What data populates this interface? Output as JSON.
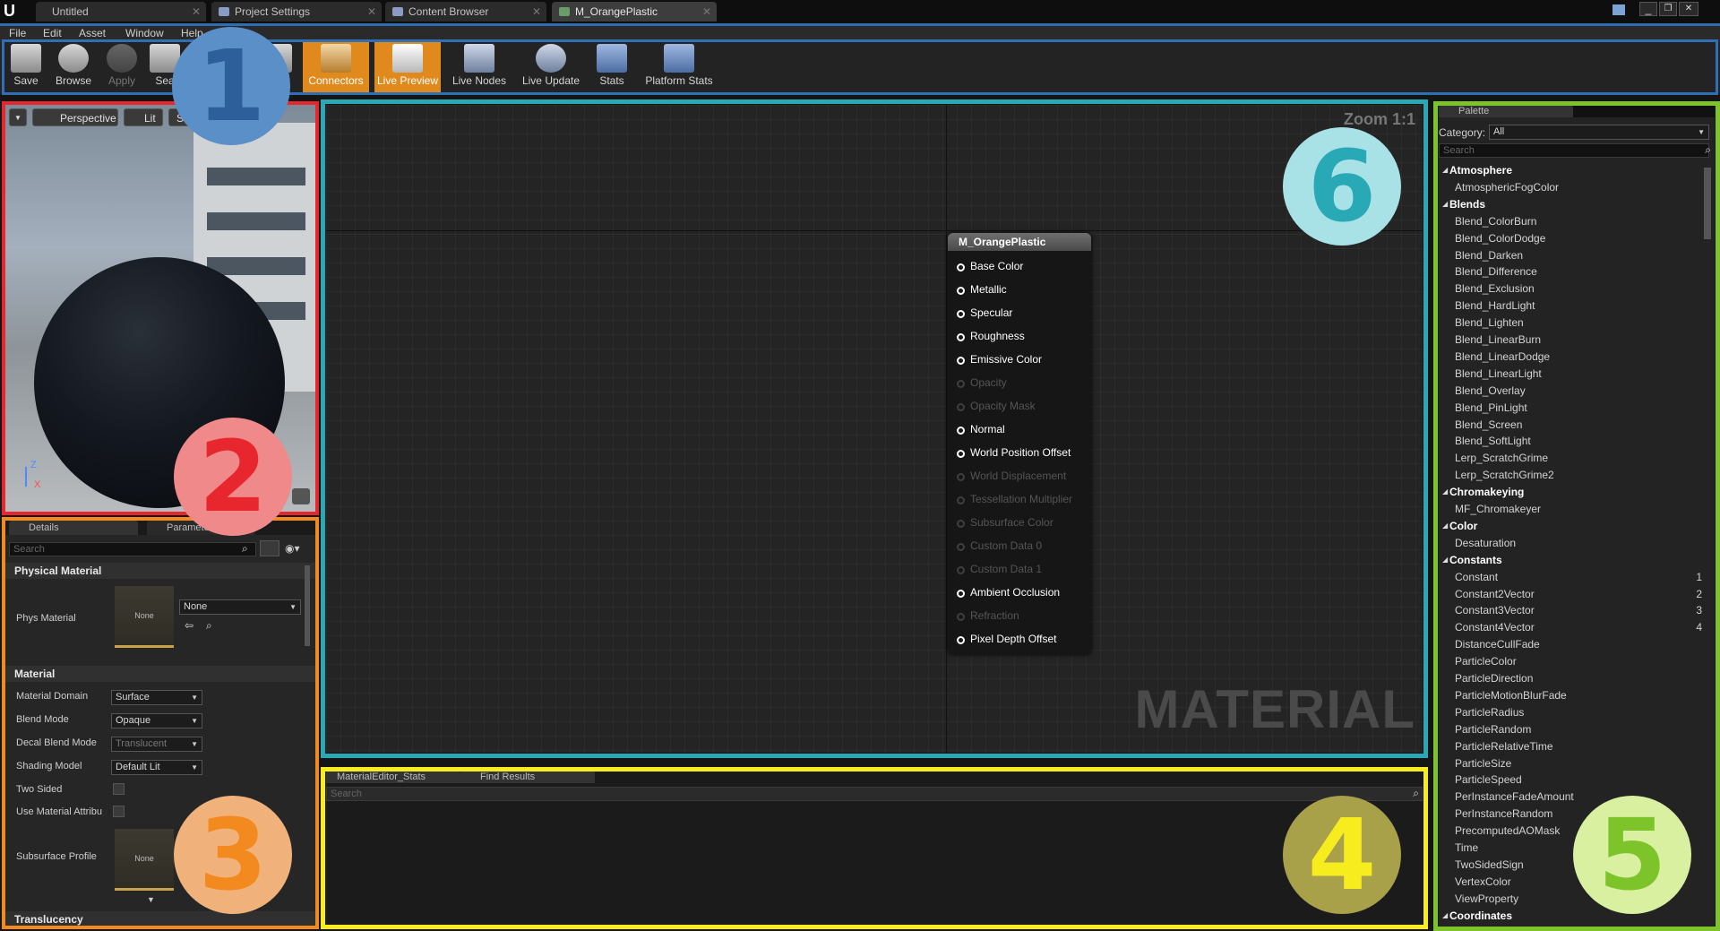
{
  "tabs": [
    {
      "label": "Untitled"
    },
    {
      "label": "Project Settings"
    },
    {
      "label": "Content Browser"
    },
    {
      "label": "M_OrangePlastic"
    }
  ],
  "menu": [
    "File",
    "Edit",
    "Asset",
    "Window",
    "Help"
  ],
  "toolbar": [
    {
      "label": "Save",
      "icon": "save-icon"
    },
    {
      "label": "Browse",
      "icon": "browse-icon"
    },
    {
      "label": "Apply",
      "icon": "apply-icon"
    },
    {
      "label": "Sea",
      "icon": "search-icon"
    },
    {
      "label": "Connectors",
      "icon": "connectors-icon"
    },
    {
      "label": "Live Preview",
      "icon": "live-preview-icon"
    },
    {
      "label": "Live Nodes",
      "icon": "live-nodes-icon"
    },
    {
      "label": "Live Update",
      "icon": "live-update-icon"
    },
    {
      "label": "Stats",
      "icon": "stats-icon"
    },
    {
      "label": "Platform Stats",
      "icon": "platform-stats-icon"
    }
  ],
  "viewport": {
    "perspective": "Perspective",
    "lit": "Lit",
    "show": "Sh",
    "axis_z": "Z",
    "axis_x": "X"
  },
  "details": {
    "tab_details": "Details",
    "tab_params": "Paramete",
    "search_placeholder": "Search",
    "cat_physical": "Physical Material",
    "phys_label": "Phys Material",
    "phys_thumb": "None",
    "phys_value": "None",
    "cat_material": "Material",
    "domain_label": "Material Domain",
    "domain_value": "Surface",
    "blend_label": "Blend Mode",
    "blend_value": "Opaque",
    "decal_label": "Decal Blend Mode",
    "decal_value": "Translucent",
    "shading_label": "Shading Model",
    "shading_value": "Default Lit",
    "twosided_label": "Two Sided",
    "usematattr_label": "Use Material Attribu",
    "subsurface_label": "Subsurface Profile",
    "subsurface_thumb": "None",
    "cat_translucency": "Translucency"
  },
  "graph": {
    "zoom": "Zoom 1:1",
    "watermark": "MATERIAL",
    "node_title": "M_OrangePlastic",
    "pins": [
      {
        "label": "Base Color",
        "active": true
      },
      {
        "label": "Metallic",
        "active": true
      },
      {
        "label": "Specular",
        "active": true
      },
      {
        "label": "Roughness",
        "active": true
      },
      {
        "label": "Emissive Color",
        "active": true
      },
      {
        "label": "Opacity",
        "active": false
      },
      {
        "label": "Opacity Mask",
        "active": false
      },
      {
        "label": "Normal",
        "active": true
      },
      {
        "label": "World Position Offset",
        "active": true
      },
      {
        "label": "World Displacement",
        "active": false
      },
      {
        "label": "Tessellation Multiplier",
        "active": false
      },
      {
        "label": "Subsurface Color",
        "active": false
      },
      {
        "label": "Custom Data 0",
        "active": false
      },
      {
        "label": "Custom Data 1",
        "active": false
      },
      {
        "label": "Ambient Occlusion",
        "active": true
      },
      {
        "label": "Refraction",
        "active": false
      },
      {
        "label": "Pixel Depth Offset",
        "active": true
      }
    ]
  },
  "stats": {
    "tab_stats": "MaterialEditor_Stats",
    "tab_find": "Find Results",
    "search_placeholder": "Search"
  },
  "palette": {
    "tab": "Palette",
    "category_label": "Category:",
    "category_value": "All",
    "search_placeholder": "Search",
    "items": [
      {
        "text": "Atmosphere",
        "type": "cat"
      },
      {
        "text": "AtmosphericFogColor",
        "type": "item"
      },
      {
        "text": "Blends",
        "type": "cat"
      },
      {
        "text": "Blend_ColorBurn",
        "type": "item"
      },
      {
        "text": "Blend_ColorDodge",
        "type": "item"
      },
      {
        "text": "Blend_Darken",
        "type": "item"
      },
      {
        "text": "Blend_Difference",
        "type": "item"
      },
      {
        "text": "Blend_Exclusion",
        "type": "item"
      },
      {
        "text": "Blend_HardLight",
        "type": "item"
      },
      {
        "text": "Blend_Lighten",
        "type": "item"
      },
      {
        "text": "Blend_LinearBurn",
        "type": "item"
      },
      {
        "text": "Blend_LinearDodge",
        "type": "item"
      },
      {
        "text": "Blend_LinearLight",
        "type": "item"
      },
      {
        "text": "Blend_Overlay",
        "type": "item"
      },
      {
        "text": "Blend_PinLight",
        "type": "item"
      },
      {
        "text": "Blend_Screen",
        "type": "item"
      },
      {
        "text": "Blend_SoftLight",
        "type": "item"
      },
      {
        "text": "Lerp_ScratchGrime",
        "type": "item"
      },
      {
        "text": "Lerp_ScratchGrime2",
        "type": "item"
      },
      {
        "text": "Chromakeying",
        "type": "cat"
      },
      {
        "text": "MF_Chromakeyer",
        "type": "item"
      },
      {
        "text": "Color",
        "type": "cat"
      },
      {
        "text": "Desaturation",
        "type": "item"
      },
      {
        "text": "Constants",
        "type": "cat"
      },
      {
        "text": "Constant",
        "type": "item",
        "hotkey": "1"
      },
      {
        "text": "Constant2Vector",
        "type": "item",
        "hotkey": "2"
      },
      {
        "text": "Constant3Vector",
        "type": "item",
        "hotkey": "3"
      },
      {
        "text": "Constant4Vector",
        "type": "item",
        "hotkey": "4"
      },
      {
        "text": "DistanceCullFade",
        "type": "item"
      },
      {
        "text": "ParticleColor",
        "type": "item"
      },
      {
        "text": "ParticleDirection",
        "type": "item"
      },
      {
        "text": "ParticleMotionBlurFade",
        "type": "item"
      },
      {
        "text": "ParticleRadius",
        "type": "item"
      },
      {
        "text": "ParticleRandom",
        "type": "item"
      },
      {
        "text": "ParticleRelativeTime",
        "type": "item"
      },
      {
        "text": "ParticleSize",
        "type": "item"
      },
      {
        "text": "ParticleSpeed",
        "type": "item"
      },
      {
        "text": "PerInstanceFadeAmount",
        "type": "item"
      },
      {
        "text": "PerInstanceRandom",
        "type": "item"
      },
      {
        "text": "PrecomputedAOMask",
        "type": "item"
      },
      {
        "text": "Time",
        "type": "item"
      },
      {
        "text": "TwoSidedSign",
        "type": "item"
      },
      {
        "text": "VertexColor",
        "type": "item"
      },
      {
        "text": "ViewProperty",
        "type": "item"
      },
      {
        "text": "Coordinates",
        "type": "cat"
      }
    ]
  },
  "callouts": [
    {
      "num": "1",
      "color": "#5b8fc7",
      "text_color": "#2d5f9a"
    },
    {
      "num": "2",
      "color": "#f08a8a",
      "text_color": "#e8262d"
    },
    {
      "num": "3",
      "color": "#f0b27a",
      "text_color": "#f28a1f"
    },
    {
      "num": "4",
      "color": "#a8a14a",
      "text_color": "#f6ec1e"
    },
    {
      "num": "5",
      "color": "#d8f0a0",
      "text_color": "#7cc42a"
    },
    {
      "num": "6",
      "color": "#a8e2e6",
      "text_color": "#29a8b5"
    }
  ],
  "frame_colors": {
    "toolbar": "#2e6fb5",
    "viewport": "#e8262d",
    "details": "#f28a1f",
    "stats": "#f6ec1e",
    "palette": "#7cc42a",
    "graph": "#29a8b5"
  }
}
